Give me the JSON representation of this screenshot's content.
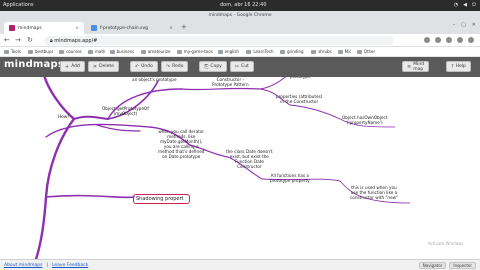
{
  "os": {
    "apps": "Applications",
    "clock": "dom, abr 16   22:40"
  },
  "window": {
    "title": "mindmaps - Google Chrome"
  },
  "tabs": [
    {
      "label": "mindmaps",
      "close": "×"
    },
    {
      "label": "f-prototype-chain.svg",
      "close": "×"
    }
  ],
  "newtab": "+",
  "address": {
    "url": "mindmaps.app/#"
  },
  "bookmarks": [
    "Tools",
    "bestbuys",
    "courses",
    "math",
    "business",
    "amateurize",
    "my-game-toos",
    "english",
    "LearnTech",
    "grinding",
    "shrubs",
    "Mic",
    "Other"
  ],
  "app": {
    "brand": "mindmaps",
    "toolbar": [
      {
        "label": "Add",
        "icon": "+"
      },
      {
        "label": "Delete",
        "icon": "✕"
      },
      {
        "label": "Undo",
        "icon": "↶"
      },
      {
        "label": "Redo",
        "icon": "↷"
      },
      {
        "label": "Copy",
        "icon": "⎘"
      },
      {
        "label": "Cut",
        "icon": "✂"
      }
    ],
    "menu_label": "Mind map",
    "help_label": "Help"
  },
  "map": {
    "nodes": [
      {
        "key": "prototype_top",
        "text": "an object's prototype"
      },
      {
        "key": "constructor",
        "text": "Constructor -\nPrototype Pattern"
      },
      {
        "key": "prototype_small",
        "text": "prototype"
      },
      {
        "key": "properties",
        "text": "properties (attributes)\nin the Constructor"
      },
      {
        "key": "howto",
        "text": "How?"
      },
      {
        "key": "getproto",
        "text": "Object.getPrototypeOf\n(myObject)"
      },
      {
        "key": "hasown",
        "text": "Object.hasOwnObject\n('propertyName')"
      },
      {
        "key": "iterator",
        "text": "when you call iterator\nmethods, like\nmyDate.getMonth(),\nyou are calling a\nmethod that's defined\non Date.prototype"
      },
      {
        "key": "classdate",
        "text": "the class Date doesn't\nexist, but exist the\nFunction Date\nConstructor"
      },
      {
        "key": "allfunctions",
        "text": "All functions has a\nprototype property"
      },
      {
        "key": "used",
        "text": "this is used when you\nuse the function like a\nconstructor with \"new\""
      }
    ],
    "selected_node": "Shadowing propert",
    "watermark": "Activate Windows"
  },
  "status": {
    "about": "About mindmaps",
    "feedback": "Leave Feedback",
    "buttons": [
      "Navigator",
      "Inspector"
    ]
  }
}
